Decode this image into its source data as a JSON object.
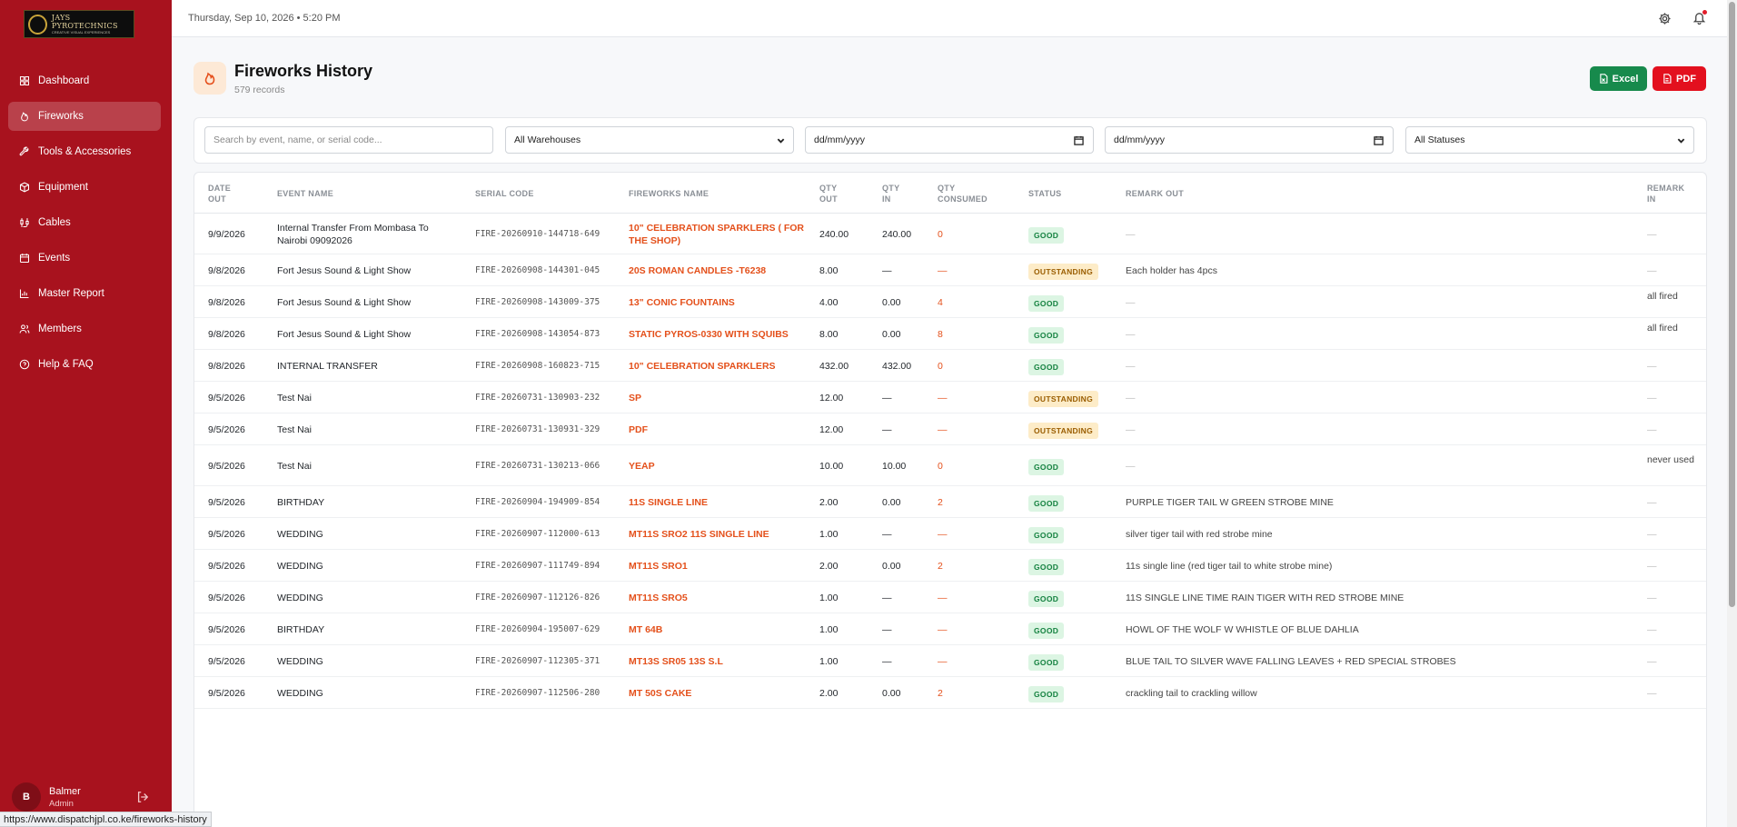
{
  "brand": {
    "logo_text": "JAYS PYROTECHNICS",
    "logo_sub": "CREATIVE VISUAL EXPERIENCES"
  },
  "sidebar": {
    "items": [
      {
        "label": "Dashboard",
        "icon": "grid-icon",
        "active": false
      },
      {
        "label": "Fireworks",
        "icon": "flame-icon",
        "active": true
      },
      {
        "label": "Tools & Accessories",
        "icon": "wrench-icon",
        "active": false
      },
      {
        "label": "Equipment",
        "icon": "box-icon",
        "active": false
      },
      {
        "label": "Cables",
        "icon": "cable-icon",
        "active": false
      },
      {
        "label": "Events",
        "icon": "calendar-icon",
        "active": false
      },
      {
        "label": "Master Report",
        "icon": "bar-chart-icon",
        "active": false
      },
      {
        "label": "Members",
        "icon": "users-icon",
        "active": false
      },
      {
        "label": "Help & FAQ",
        "icon": "help-circle-icon",
        "active": false
      }
    ],
    "user": {
      "initial": "B",
      "name": "Balmer",
      "role": "Admin"
    }
  },
  "topbar": {
    "datetime": "Thursday, Sep 10, 2026  •  5:20 PM"
  },
  "header": {
    "title": "Fireworks History",
    "subtitle": "579 records",
    "excel_label": "Excel",
    "pdf_label": "PDF"
  },
  "filters": {
    "search_placeholder": "Search by event, name, or serial code...",
    "warehouse": "All Warehouses",
    "date_from": "dd/mm/yyyy",
    "date_to": "dd/mm/yyyy",
    "status": "All Statuses"
  },
  "table": {
    "headers": {
      "date_out": "DATE\nOUT",
      "event_name": "EVENT NAME",
      "serial_code": "SERIAL CODE",
      "fireworks_name": "FIREWORKS NAME",
      "qty_out": "QTY\nOUT",
      "qty_in": "QTY\nIN",
      "qty_consumed": "QTY\nCONSUMED",
      "status": "STATUS",
      "remark_out": "REMARK OUT",
      "remark_in": "REMARK\nIN"
    },
    "rows": [
      {
        "date": "9/9/2026",
        "event": "Internal Transfer From Mombasa To Nairobi 09092026",
        "serial": "FIRE-20260910-144718-649",
        "name": "10\" CELEBRATION SPARKLERS ( FOR THE SHOP)",
        "qty_out": "240.00",
        "qty_in": "240.00",
        "consumed": "0",
        "status": "GOOD",
        "remark_out": "—",
        "remark_in": "—"
      },
      {
        "date": "9/8/2026",
        "event": "Fort Jesus Sound & Light Show",
        "serial": "FIRE-20260908-144301-045",
        "name": "20S ROMAN CANDLES -T6238",
        "qty_out": "8.00",
        "qty_in": "—",
        "consumed": "—",
        "status": "OUTSTANDING",
        "remark_out": "Each holder has 4pcs",
        "remark_in": "—"
      },
      {
        "date": "9/8/2026",
        "event": "Fort Jesus Sound & Light Show",
        "serial": "FIRE-20260908-143009-375",
        "name": "13\" CONIC FOUNTAINS",
        "qty_out": "4.00",
        "qty_in": "0.00",
        "consumed": "4",
        "status": "GOOD",
        "remark_out": "—",
        "remark_in": "all fired"
      },
      {
        "date": "9/8/2026",
        "event": "Fort Jesus Sound & Light Show",
        "serial": "FIRE-20260908-143054-873",
        "name": "STATIC PYROS-0330 WITH SQUIBS",
        "qty_out": "8.00",
        "qty_in": "0.00",
        "consumed": "8",
        "status": "GOOD",
        "remark_out": "—",
        "remark_in": "all fired"
      },
      {
        "date": "9/8/2026",
        "event": "INTERNAL TRANSFER",
        "serial": "FIRE-20260908-160823-715",
        "name": "10\" CELEBRATION SPARKLERS",
        "qty_out": "432.00",
        "qty_in": "432.00",
        "consumed": "0",
        "status": "GOOD",
        "remark_out": "—",
        "remark_in": "—"
      },
      {
        "date": "9/5/2026",
        "event": "Test Nai",
        "serial": "FIRE-20260731-130903-232",
        "name": "SP",
        "qty_out": "12.00",
        "qty_in": "—",
        "consumed": "—",
        "status": "OUTSTANDING",
        "remark_out": "—",
        "remark_in": "—"
      },
      {
        "date": "9/5/2026",
        "event": "Test Nai",
        "serial": "FIRE-20260731-130931-329",
        "name": "PDF",
        "qty_out": "12.00",
        "qty_in": "—",
        "consumed": "—",
        "status": "OUTSTANDING",
        "remark_out": "—",
        "remark_in": "—"
      },
      {
        "date": "9/5/2026",
        "event": "Test Nai",
        "serial": "FIRE-20260731-130213-066",
        "name": "YEAP",
        "qty_out": "10.00",
        "qty_in": "10.00",
        "consumed": "0",
        "status": "GOOD",
        "remark_out": "—",
        "remark_in": "never used"
      },
      {
        "date": "9/5/2026",
        "event": "BIRTHDAY",
        "serial": "FIRE-20260904-194909-854",
        "name": "11S SINGLE LINE",
        "qty_out": "2.00",
        "qty_in": "0.00",
        "consumed": "2",
        "status": "GOOD",
        "remark_out": "PURPLE TIGER TAIL W GREEN STROBE MINE",
        "remark_in": "—"
      },
      {
        "date": "9/5/2026",
        "event": "WEDDING",
        "serial": "FIRE-20260907-112000-613",
        "name": "MT11S SRO2 11S SINGLE LINE",
        "qty_out": "1.00",
        "qty_in": "—",
        "consumed": "—",
        "status": "GOOD",
        "remark_out": "silver tiger tail with red strobe mine",
        "remark_in": "—"
      },
      {
        "date": "9/5/2026",
        "event": "WEDDING",
        "serial": "FIRE-20260907-111749-894",
        "name": "MT11S SRO1",
        "qty_out": "2.00",
        "qty_in": "0.00",
        "consumed": "2",
        "status": "GOOD",
        "remark_out": "11s single line (red tiger tail to white strobe mine)",
        "remark_in": "—"
      },
      {
        "date": "9/5/2026",
        "event": "WEDDING",
        "serial": "FIRE-20260907-112126-826",
        "name": "MT11S SRO5",
        "qty_out": "1.00",
        "qty_in": "—",
        "consumed": "—",
        "status": "GOOD",
        "remark_out": "11S SINGLE LINE TIME RAIN TIGER WITH RED STROBE MINE",
        "remark_in": "—"
      },
      {
        "date": "9/5/2026",
        "event": "BIRTHDAY",
        "serial": "FIRE-20260904-195007-629",
        "name": "MT 64B",
        "qty_out": "1.00",
        "qty_in": "—",
        "consumed": "—",
        "status": "GOOD",
        "remark_out": "HOWL OF THE WOLF W WHISTLE OF BLUE DAHLIA",
        "remark_in": "—"
      },
      {
        "date": "9/5/2026",
        "event": "WEDDING",
        "serial": "FIRE-20260907-112305-371",
        "name": "MT13S SR05 13S S.L",
        "qty_out": "1.00",
        "qty_in": "—",
        "consumed": "—",
        "status": "GOOD",
        "remark_out": "BLUE TAIL TO SILVER WAVE FALLING LEAVES + RED SPECIAL STROBES",
        "remark_in": "—"
      },
      {
        "date": "9/5/2026",
        "event": "WEDDING",
        "serial": "FIRE-20260907-112506-280",
        "name": "MT 50S CAKE",
        "qty_out": "2.00",
        "qty_in": "0.00",
        "consumed": "2",
        "status": "GOOD",
        "remark_out": "crackling tail to crackling willow",
        "remark_in": "—"
      }
    ]
  },
  "statusbar": {
    "url": "https://www.dispatchjpl.co.ke/fireworks-history"
  },
  "colors": {
    "sidebar": "#a8121e",
    "accent": "#e4501b",
    "excel": "#178a4c",
    "pdf": "#e3101e"
  }
}
